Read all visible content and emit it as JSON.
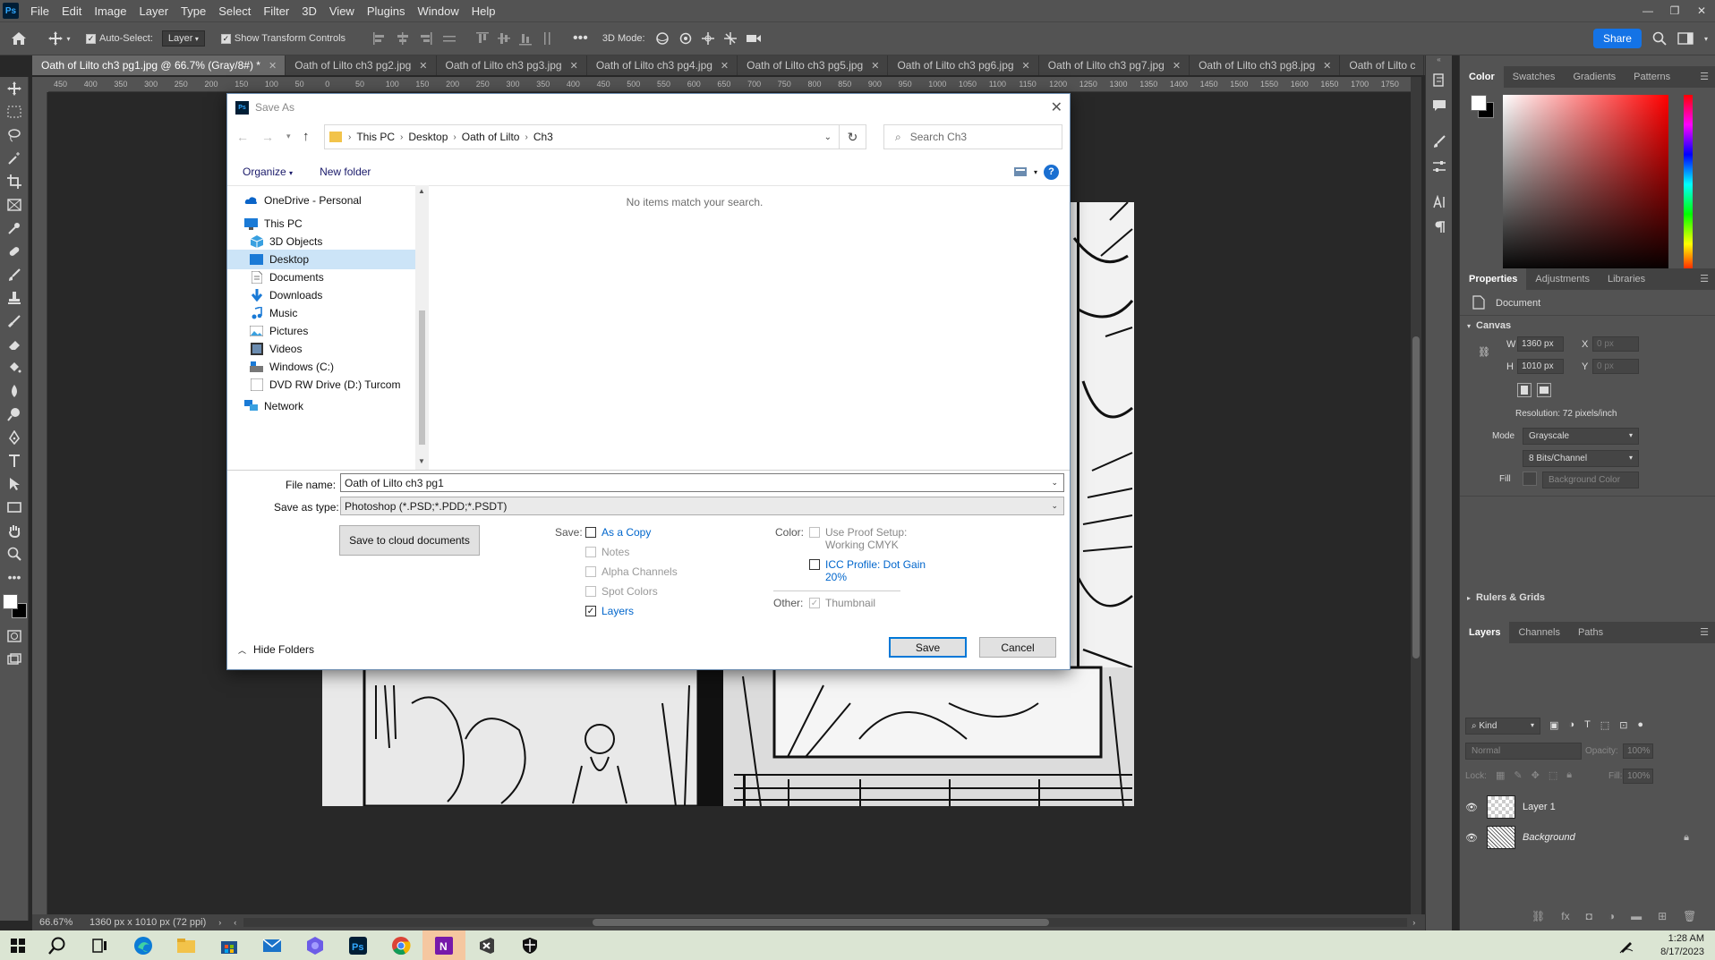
{
  "app": {
    "menu": [
      "File",
      "Edit",
      "Image",
      "Layer",
      "Type",
      "Select",
      "Filter",
      "3D",
      "View",
      "Plugins",
      "Window",
      "Help"
    ],
    "ps_logo": "Ps"
  },
  "options": {
    "auto_select_label": "Auto-Select:",
    "auto_select_value": "Layer",
    "transform_label": "Show Transform Controls",
    "mode3d_label": "3D Mode:",
    "share_label": "Share"
  },
  "tabs": [
    {
      "label": "Oath of Lilto ch3 pg1.jpg @ 66.7% (Gray/8#) *",
      "active": true
    },
    {
      "label": "Oath of Lilto ch3 pg2.jpg"
    },
    {
      "label": "Oath of Lilto ch3 pg3.jpg"
    },
    {
      "label": "Oath of Lilto ch3 pg4.jpg"
    },
    {
      "label": "Oath of Lilto ch3 pg5.jpg"
    },
    {
      "label": "Oath of Lilto ch3 pg6.jpg"
    },
    {
      "label": "Oath of Lilto ch3 pg7.jpg"
    },
    {
      "label": "Oath of Lilto ch3 pg8.jpg"
    },
    {
      "label": "Oath of Lilto c"
    }
  ],
  "ruler_ticks": [
    "450",
    "400",
    "350",
    "300",
    "250",
    "200",
    "150",
    "100",
    "50",
    "0",
    "50",
    "100",
    "150",
    "200",
    "250",
    "300",
    "350",
    "400",
    "450",
    "500",
    "550",
    "600",
    "650",
    "700",
    "750",
    "800",
    "850",
    "900",
    "950",
    "1000",
    "1050",
    "1100",
    "1150",
    "1200",
    "1250",
    "1300",
    "1350",
    "1400",
    "1450",
    "1500",
    "1550",
    "1600",
    "1650",
    "1700",
    "1750",
    "18"
  ],
  "status": {
    "zoom": "66.67%",
    "doc_info": "1360 px x 1010 px (72 ppi)"
  },
  "color_panel": {
    "tabs": [
      "Color",
      "Swatches",
      "Gradients",
      "Patterns"
    ],
    "fg": "#ffffff",
    "bg": "#000000"
  },
  "properties": {
    "tabs": [
      "Properties",
      "Adjustments",
      "Libraries"
    ],
    "doc_label": "Document",
    "canvas_heading": "Canvas",
    "w_label": "W",
    "w_value": "1360 px",
    "h_label": "H",
    "h_value": "1010 px",
    "x_label": "X",
    "x_value": "0 px",
    "y_label": "Y",
    "y_value": "0 px",
    "resolution": "Resolution: 72 pixels/inch",
    "mode_label": "Mode",
    "mode_value": "Grayscale",
    "bits_value": "8 Bits/Channel",
    "fill_label": "Fill",
    "fill_value": "Background Color",
    "rulers_heading": "Rulers & Grids"
  },
  "layers_panel": {
    "tabs": [
      "Layers",
      "Channels",
      "Paths"
    ],
    "kind": "Kind",
    "blend": "Normal",
    "opacity_label": "Opacity:",
    "opacity_value": "100%",
    "lock_label": "Lock:",
    "fill_label": "Fill:",
    "fill_value": "100%",
    "layers": [
      {
        "name": "Layer 1"
      },
      {
        "name": "Background"
      }
    ]
  },
  "dialog": {
    "title": "Save As",
    "breadcrumbs": [
      "This PC",
      "Desktop",
      "Oath of Lilto",
      "Ch3"
    ],
    "search_placeholder": "Search Ch3",
    "organize": "Organize",
    "new_folder": "New folder",
    "empty_msg": "No items match your search.",
    "tree": [
      {
        "label": "OneDrive - Personal",
        "icon": "cloud-icon",
        "indent": 0
      },
      {
        "label": "This PC",
        "icon": "computer-icon",
        "indent": 0
      },
      {
        "label": "3D Objects",
        "icon": "cube-icon",
        "indent": 1
      },
      {
        "label": "Desktop",
        "icon": "desktop-icon",
        "indent": 1,
        "selected": true
      },
      {
        "label": "Documents",
        "icon": "document-icon",
        "indent": 1
      },
      {
        "label": "Downloads",
        "icon": "download-icon",
        "indent": 1
      },
      {
        "label": "Music",
        "icon": "music-icon",
        "indent": 1
      },
      {
        "label": "Pictures",
        "icon": "pictures-icon",
        "indent": 1
      },
      {
        "label": "Videos",
        "icon": "video-icon",
        "indent": 1
      },
      {
        "label": "Windows (C:)",
        "icon": "drive-icon",
        "indent": 1
      },
      {
        "label": "DVD RW Drive (D:) Turcom",
        "icon": "dvd-icon",
        "indent": 1
      },
      {
        "label": "Network",
        "icon": "network-icon",
        "indent": 0
      }
    ],
    "file_name_label": "File name:",
    "file_name_value": "Oath of Lilto ch3 pg1",
    "save_type_label": "Save as type:",
    "save_type_value": "Photoshop (*.PSD;*.PDD;*.PSDT)",
    "cloud_button": "Save to cloud documents",
    "save_label": "Save:",
    "save_opts": [
      {
        "label": "As a Copy",
        "checked": false,
        "enabled": true
      },
      {
        "label": "Notes",
        "checked": false,
        "enabled": false
      },
      {
        "label": "Alpha Channels",
        "checked": false,
        "enabled": false
      },
      {
        "label": "Spot Colors",
        "checked": false,
        "enabled": false
      },
      {
        "label": "Layers",
        "checked": true,
        "enabled": true
      }
    ],
    "color_label": "Color:",
    "proof_line1": "Use Proof Setup:",
    "proof_line2": "Working CMYK",
    "icc_line1": "ICC Profile:  Dot Gain",
    "icc_line2": "20%",
    "other_label": "Other:",
    "thumbnail": "Thumbnail",
    "hide_folders": "Hide Folders",
    "save_button": "Save",
    "cancel_button": "Cancel"
  },
  "taskbar": {
    "time": "1:28 AM",
    "date": "8/17/2023"
  }
}
